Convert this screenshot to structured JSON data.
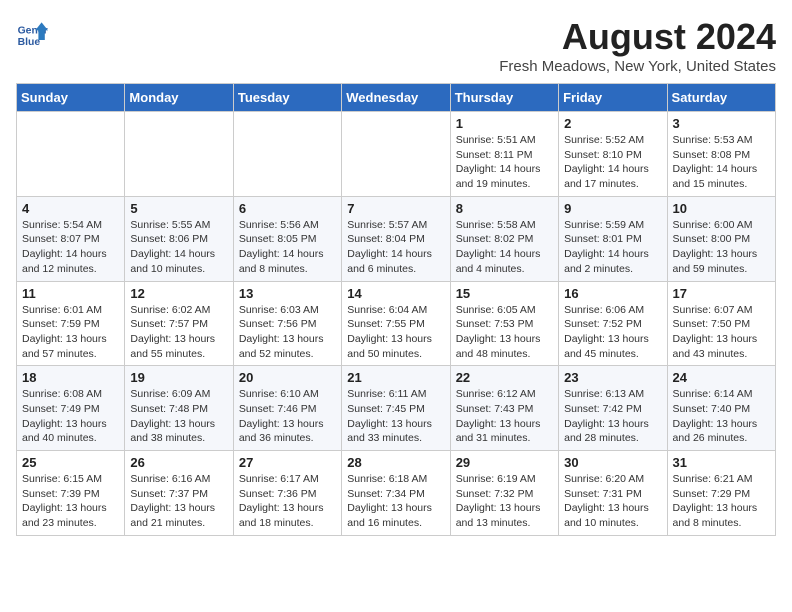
{
  "header": {
    "logo_line1": "General",
    "logo_line2": "Blue",
    "month_year": "August 2024",
    "location": "Fresh Meadows, New York, United States"
  },
  "weekdays": [
    "Sunday",
    "Monday",
    "Tuesday",
    "Wednesday",
    "Thursday",
    "Friday",
    "Saturday"
  ],
  "weeks": [
    [
      {
        "day": "",
        "info": ""
      },
      {
        "day": "",
        "info": ""
      },
      {
        "day": "",
        "info": ""
      },
      {
        "day": "",
        "info": ""
      },
      {
        "day": "1",
        "info": "Sunrise: 5:51 AM\nSunset: 8:11 PM\nDaylight: 14 hours\nand 19 minutes."
      },
      {
        "day": "2",
        "info": "Sunrise: 5:52 AM\nSunset: 8:10 PM\nDaylight: 14 hours\nand 17 minutes."
      },
      {
        "day": "3",
        "info": "Sunrise: 5:53 AM\nSunset: 8:08 PM\nDaylight: 14 hours\nand 15 minutes."
      }
    ],
    [
      {
        "day": "4",
        "info": "Sunrise: 5:54 AM\nSunset: 8:07 PM\nDaylight: 14 hours\nand 12 minutes."
      },
      {
        "day": "5",
        "info": "Sunrise: 5:55 AM\nSunset: 8:06 PM\nDaylight: 14 hours\nand 10 minutes."
      },
      {
        "day": "6",
        "info": "Sunrise: 5:56 AM\nSunset: 8:05 PM\nDaylight: 14 hours\nand 8 minutes."
      },
      {
        "day": "7",
        "info": "Sunrise: 5:57 AM\nSunset: 8:04 PM\nDaylight: 14 hours\nand 6 minutes."
      },
      {
        "day": "8",
        "info": "Sunrise: 5:58 AM\nSunset: 8:02 PM\nDaylight: 14 hours\nand 4 minutes."
      },
      {
        "day": "9",
        "info": "Sunrise: 5:59 AM\nSunset: 8:01 PM\nDaylight: 14 hours\nand 2 minutes."
      },
      {
        "day": "10",
        "info": "Sunrise: 6:00 AM\nSunset: 8:00 PM\nDaylight: 13 hours\nand 59 minutes."
      }
    ],
    [
      {
        "day": "11",
        "info": "Sunrise: 6:01 AM\nSunset: 7:59 PM\nDaylight: 13 hours\nand 57 minutes."
      },
      {
        "day": "12",
        "info": "Sunrise: 6:02 AM\nSunset: 7:57 PM\nDaylight: 13 hours\nand 55 minutes."
      },
      {
        "day": "13",
        "info": "Sunrise: 6:03 AM\nSunset: 7:56 PM\nDaylight: 13 hours\nand 52 minutes."
      },
      {
        "day": "14",
        "info": "Sunrise: 6:04 AM\nSunset: 7:55 PM\nDaylight: 13 hours\nand 50 minutes."
      },
      {
        "day": "15",
        "info": "Sunrise: 6:05 AM\nSunset: 7:53 PM\nDaylight: 13 hours\nand 48 minutes."
      },
      {
        "day": "16",
        "info": "Sunrise: 6:06 AM\nSunset: 7:52 PM\nDaylight: 13 hours\nand 45 minutes."
      },
      {
        "day": "17",
        "info": "Sunrise: 6:07 AM\nSunset: 7:50 PM\nDaylight: 13 hours\nand 43 minutes."
      }
    ],
    [
      {
        "day": "18",
        "info": "Sunrise: 6:08 AM\nSunset: 7:49 PM\nDaylight: 13 hours\nand 40 minutes."
      },
      {
        "day": "19",
        "info": "Sunrise: 6:09 AM\nSunset: 7:48 PM\nDaylight: 13 hours\nand 38 minutes."
      },
      {
        "day": "20",
        "info": "Sunrise: 6:10 AM\nSunset: 7:46 PM\nDaylight: 13 hours\nand 36 minutes."
      },
      {
        "day": "21",
        "info": "Sunrise: 6:11 AM\nSunset: 7:45 PM\nDaylight: 13 hours\nand 33 minutes."
      },
      {
        "day": "22",
        "info": "Sunrise: 6:12 AM\nSunset: 7:43 PM\nDaylight: 13 hours\nand 31 minutes."
      },
      {
        "day": "23",
        "info": "Sunrise: 6:13 AM\nSunset: 7:42 PM\nDaylight: 13 hours\nand 28 minutes."
      },
      {
        "day": "24",
        "info": "Sunrise: 6:14 AM\nSunset: 7:40 PM\nDaylight: 13 hours\nand 26 minutes."
      }
    ],
    [
      {
        "day": "25",
        "info": "Sunrise: 6:15 AM\nSunset: 7:39 PM\nDaylight: 13 hours\nand 23 minutes."
      },
      {
        "day": "26",
        "info": "Sunrise: 6:16 AM\nSunset: 7:37 PM\nDaylight: 13 hours\nand 21 minutes."
      },
      {
        "day": "27",
        "info": "Sunrise: 6:17 AM\nSunset: 7:36 PM\nDaylight: 13 hours\nand 18 minutes."
      },
      {
        "day": "28",
        "info": "Sunrise: 6:18 AM\nSunset: 7:34 PM\nDaylight: 13 hours\nand 16 minutes."
      },
      {
        "day": "29",
        "info": "Sunrise: 6:19 AM\nSunset: 7:32 PM\nDaylight: 13 hours\nand 13 minutes."
      },
      {
        "day": "30",
        "info": "Sunrise: 6:20 AM\nSunset: 7:31 PM\nDaylight: 13 hours\nand 10 minutes."
      },
      {
        "day": "31",
        "info": "Sunrise: 6:21 AM\nSunset: 7:29 PM\nDaylight: 13 hours\nand 8 minutes."
      }
    ]
  ]
}
